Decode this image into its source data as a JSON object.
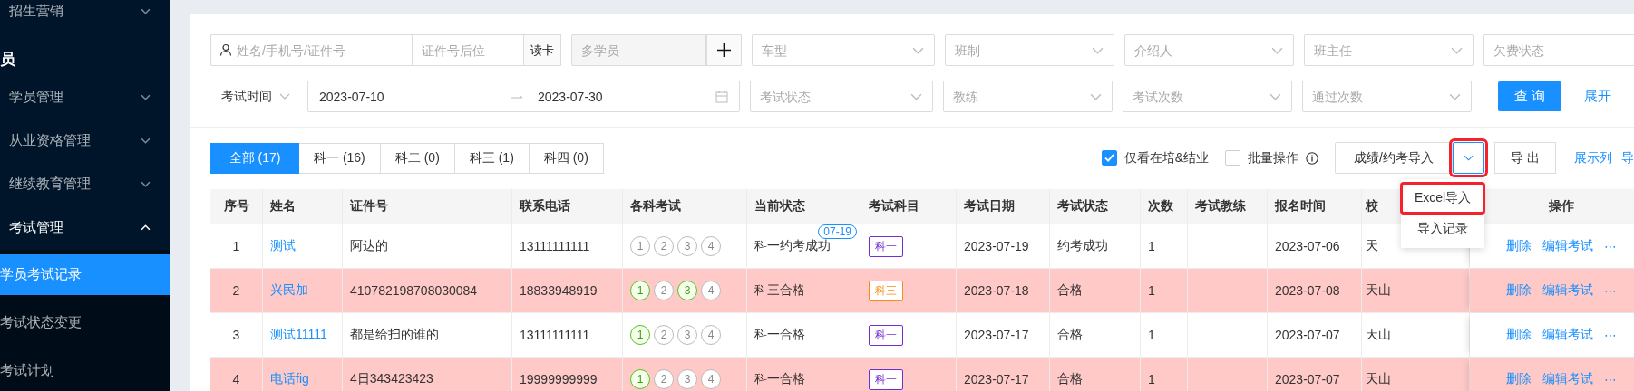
{
  "sidebar": {
    "items": [
      {
        "label": "招生营销",
        "kind": "menu",
        "expanded": false
      },
      {
        "label": "员",
        "kind": "group"
      },
      {
        "label": "学员管理",
        "kind": "menu",
        "expanded": false
      },
      {
        "label": "从业资格管理",
        "kind": "menu",
        "expanded": false
      },
      {
        "label": "继续教育管理",
        "kind": "menu",
        "expanded": false
      },
      {
        "label": "考试管理",
        "kind": "menu",
        "expanded": true,
        "children": [
          {
            "label": "学员考试记录",
            "selected": true
          },
          {
            "label": "考试状态变更",
            "selected": false
          },
          {
            "label": "考试计划",
            "selected": false
          }
        ]
      }
    ]
  },
  "filters": {
    "name_field": {
      "placeholder": "姓名/手机号/证件号"
    },
    "id_suffix_field": {
      "placeholder": "证件号后位"
    },
    "read_card_button": "读卡",
    "multi_student_field": {
      "placeholder": "多学员"
    },
    "selects_row1": [
      {
        "placeholder": "车型"
      },
      {
        "placeholder": "班制"
      },
      {
        "placeholder": "介绍人"
      },
      {
        "placeholder": "班主任"
      },
      {
        "placeholder": "欠费状态"
      }
    ],
    "time_type": "考试时间",
    "date_range": {
      "start": "2023-07-10",
      "end": "2023-07-30"
    },
    "selects_row2": [
      {
        "placeholder": "考试状态"
      },
      {
        "placeholder": "教练"
      },
      {
        "placeholder": "考试次数"
      },
      {
        "placeholder": "通过次数"
      }
    ],
    "query_button": "查 询",
    "expand_link": "展开"
  },
  "subject_tabs": [
    {
      "label": "全部 (17)",
      "selected": true
    },
    {
      "label": "科一 (16)",
      "selected": false
    },
    {
      "label": "科二 (0)",
      "selected": false
    },
    {
      "label": "科三 (1)",
      "selected": false
    },
    {
      "label": "科四 (0)",
      "selected": false
    }
  ],
  "toolbar": {
    "checkboxes": [
      {
        "label": "仅看在培&结业",
        "checked": true,
        "info": false
      },
      {
        "label": "批量操作",
        "checked": false,
        "info": true
      }
    ],
    "import_button": "成绩/约考导入",
    "import_toggle_annotated": true,
    "import_menu": [
      {
        "label": "Excel导入",
        "annotated": true
      },
      {
        "label": "导入记录",
        "annotated": false
      }
    ],
    "export_button": "导 出",
    "columns_link": "展示列",
    "cut_link": "导"
  },
  "table": {
    "columns": [
      "序号",
      "姓名",
      "证件号",
      "联系电话",
      "各科考试",
      "当前状态",
      "考试科目",
      "考试日期",
      "考试状态",
      "次数",
      "考试教练",
      "报名时间",
      "校",
      "操作"
    ],
    "rows": [
      {
        "no": "1",
        "name": "测试",
        "id": "阿达的",
        "phone": "13111111111",
        "subjects": [
          {
            "label": "1",
            "passed": false
          },
          {
            "label": "2",
            "passed": false
          },
          {
            "label": "3",
            "passed": false
          },
          {
            "label": "4",
            "passed": false
          }
        ],
        "status": "科一约考成功",
        "badge": "07-19",
        "tag": {
          "label": "科一",
          "color": "#722ed1"
        },
        "date": "2023-07-19",
        "exam_status": "约考成功",
        "count": "1",
        "coach": "",
        "signup": "2023-07-06",
        "campus": "天",
        "actions": [
          "删除",
          "编辑考试",
          "⋯"
        ],
        "highlighted": false
      },
      {
        "no": "2",
        "name": "兴民加",
        "id": "410782198708030084",
        "phone": "18833948919",
        "subjects": [
          {
            "label": "1",
            "passed": true
          },
          {
            "label": "2",
            "passed": false
          },
          {
            "label": "3",
            "passed": true
          },
          {
            "label": "4",
            "passed": false
          }
        ],
        "status": "科三合格",
        "tag": {
          "label": "科三",
          "color": "#fa8c16"
        },
        "date": "2023-07-18",
        "exam_status": "合格",
        "count": "1",
        "coach": "",
        "signup": "2023-07-08",
        "campus": "天山",
        "actions": [
          "删除",
          "编辑考试",
          "⋯"
        ],
        "highlighted": true
      },
      {
        "no": "3",
        "name": "测试11111",
        "id": "都是给扫的谁的",
        "phone": "13111111111",
        "subjects": [
          {
            "label": "1",
            "passed": true
          },
          {
            "label": "2",
            "passed": false
          },
          {
            "label": "3",
            "passed": false
          },
          {
            "label": "4",
            "passed": false
          }
        ],
        "status": "科一合格",
        "tag": {
          "label": "科一",
          "color": "#722ed1"
        },
        "date": "2023-07-17",
        "exam_status": "合格",
        "count": "1",
        "coach": "",
        "signup": "2023-07-07",
        "campus": "天山",
        "actions": [
          "删除",
          "编辑考试",
          "⋯"
        ],
        "highlighted": false
      },
      {
        "no": "4",
        "name": "电话fig",
        "id": "4日343423423",
        "phone": "19999999999",
        "subjects": [
          {
            "label": "1",
            "passed": true
          },
          {
            "label": "2",
            "passed": false
          },
          {
            "label": "3",
            "passed": false
          },
          {
            "label": "4",
            "passed": false
          }
        ],
        "status": "科一合格",
        "tag": {
          "label": "科一",
          "color": "#722ed1"
        },
        "date": "2023-07-17",
        "exam_status": "合格",
        "count": "1",
        "coach": "",
        "signup": "2023-07-07",
        "campus": "天山",
        "actions": [
          "删除",
          "编辑考试",
          "⋯"
        ],
        "highlighted": true
      }
    ]
  }
}
